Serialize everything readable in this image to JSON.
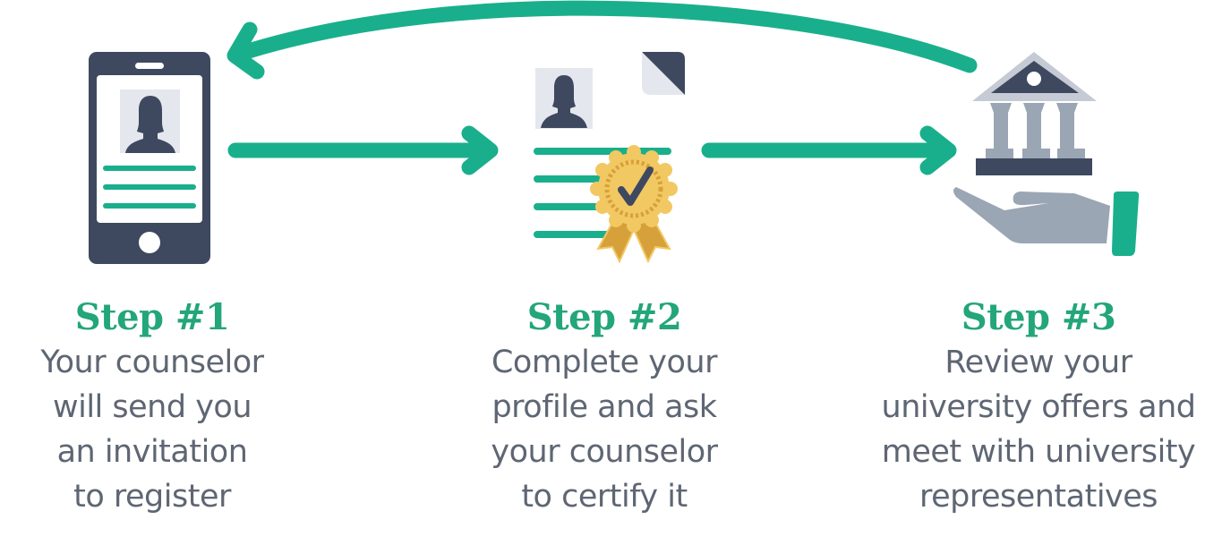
{
  "colors": {
    "accent": "#1aaf8c",
    "title_green": "#23a679",
    "text_gray": "#5e6673",
    "dark_navy": "#3e4960",
    "light_gray": "#e4e7ed",
    "mid_gray": "#9ba6b4",
    "gold": "#f2c862",
    "gold_dark": "#d6a03a"
  },
  "steps": [
    {
      "title": "Step #1",
      "icon": "smartphone-profile-icon",
      "lines": [
        "Your counselor",
        "will send you",
        "an invitation",
        "to register"
      ]
    },
    {
      "title": "Step #2",
      "icon": "certified-profile-document-icon",
      "lines": [
        "Complete your",
        "profile and ask",
        "your counselor",
        "to certify it"
      ]
    },
    {
      "title": "Step #3",
      "icon": "university-in-hand-icon",
      "lines": [
        "Review your",
        "university offers and",
        "meet with university",
        "representatives"
      ]
    }
  ],
  "arrows": [
    {
      "name": "arrow-step1-to-step2",
      "direction": "right"
    },
    {
      "name": "arrow-step2-to-step3",
      "direction": "right"
    },
    {
      "name": "arrow-step3-back-to-step1",
      "direction": "left-curved"
    }
  ]
}
